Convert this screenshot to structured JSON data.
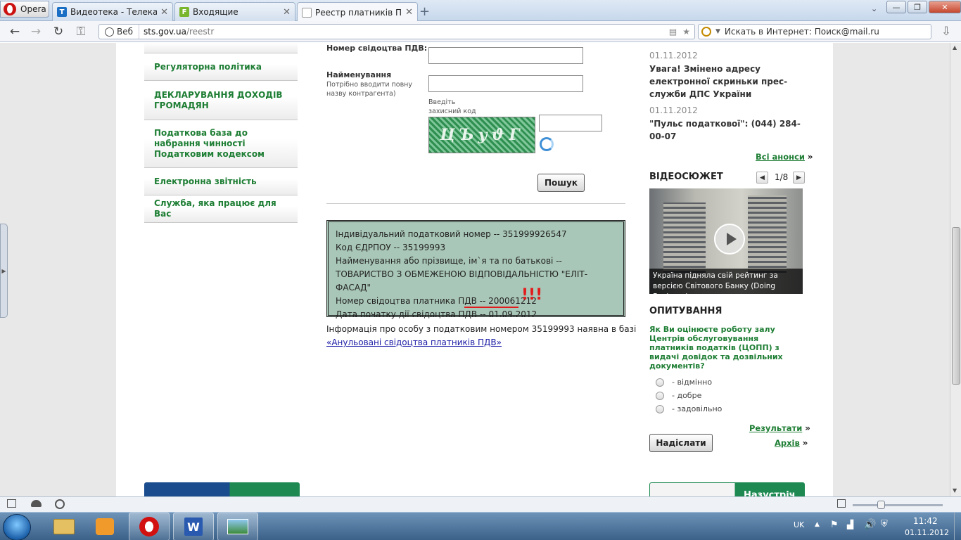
{
  "browser": {
    "app_label": "Opera",
    "tabs": [
      {
        "title": "Видеотека - Телекана...",
        "favicon": "T",
        "color": "#1a6fc4"
      },
      {
        "title": "Входящие",
        "favicon": "F",
        "color": "#7ab62d"
      },
      {
        "title": "Реестр платників ПДВ...",
        "favicon": "",
        "color": "#cccccc"
      }
    ],
    "web_chip": "Веб",
    "url_host": "sts.gov.ua",
    "url_path": "/reestr",
    "search_placeholder": "Искать в Интернет: Поиск@mail.ru"
  },
  "sidebar": {
    "items": [
      {
        "label": "Регуляторна політика"
      },
      {
        "label": "ДЕКЛАРУВАННЯ ДОХОДІВ ГРОМАДЯН"
      },
      {
        "label": "Податкова база до набрання чинності Податковим кодексом"
      },
      {
        "label": "Електронна звітність"
      },
      {
        "label": "Служба, яка працює для Вас"
      }
    ]
  },
  "form": {
    "cert_label": "Номер свідоцтва ПДВ:",
    "name_label": "Найменування",
    "name_hint": "Потрібно вводити повну назву контрагента)",
    "captcha_hint": "Введіть захисний код",
    "search_button": "Пошук"
  },
  "result": {
    "lines": [
      "Індивідуальний податковий номер -- 351999926547",
      "Код ЄДРПОУ -- 35199993",
      "Найменування або прізвище, ім`я та по батькові -- ТОВАРИСТВО З ОБМЕЖЕНОЮ ВІДПОВІДАЛЬНІСТЮ \"ЕЛІТ-ФАСАД\"",
      "Номер свідоцтва платника ПДВ -- 200061212"
    ],
    "date_prefix": "Дата початку дії свідоцтва ПДВ --",
    "date_value": "01.09.2012",
    "exclaim": "!!!",
    "info_text": "Інформація про особу з податковим номером 35199993 наявна в базі",
    "info_link": "«Анульовані свідоцтва платників ПДВ»"
  },
  "news": [
    {
      "date": "01.11.2012",
      "text": "Увага! Змінено адресу електронної скриньки прес-служби ДПС України"
    },
    {
      "date": "01.11.2012",
      "text": "\"Пульс податкової\": (044) 284-00-07"
    }
  ],
  "all_announcements": "Всі анонси",
  "video": {
    "heading": "ВІДЕОСЮЖЕТ",
    "pager": "1/8",
    "caption": "Україна підняла свій рейтинг за версією Світового Банку (Doing Business)"
  },
  "poll": {
    "heading": "ОПИТУВАННЯ",
    "question": "Як Ви оцінюєте роботу залу Центрів обслуговування платників податків (ЦОПП) з видачі довідок та дозвільних документів?",
    "options": [
      "- відмінно",
      "- добре",
      "- задовільно"
    ],
    "results_link": "Результати",
    "archive_link": "Архів",
    "submit_button": "Надіслати"
  },
  "banner_right": "Назустріч",
  "taskbar": {
    "lang": "UK",
    "time": "11:42",
    "date": "01.11.2012"
  }
}
